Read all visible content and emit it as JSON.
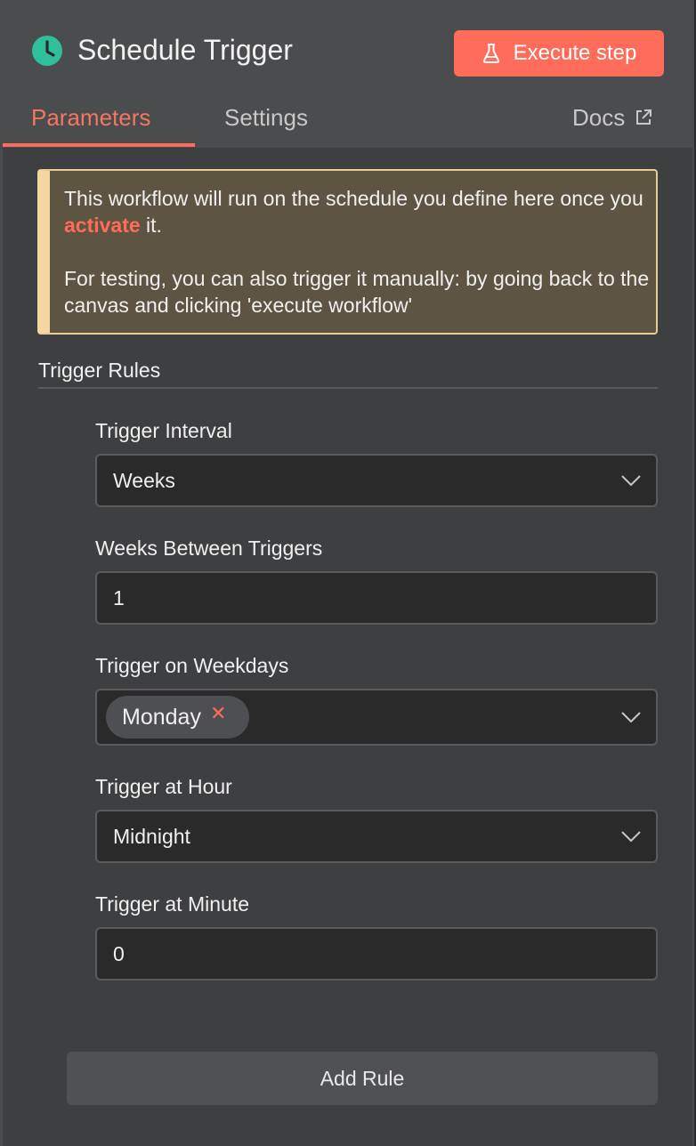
{
  "header": {
    "title": "Schedule Trigger",
    "execute_label": "Execute step",
    "icon": "clock-icon"
  },
  "tabs": [
    {
      "label": "Parameters",
      "active": true
    },
    {
      "label": "Settings",
      "active": false
    }
  ],
  "docs_label": "Docs",
  "notice": {
    "line1_pre": "This workflow will run on the schedule you define here once you ",
    "link": "activate",
    "line1_post": " it.",
    "line2": "For testing, you can also trigger it manually: by going back to the canvas and clicking 'execute workflow'"
  },
  "section_title": "Trigger Rules",
  "fields": {
    "interval": {
      "label": "Trigger Interval",
      "value": "Weeks"
    },
    "weeks_between": {
      "label": "Weeks Between Triggers",
      "value": "1"
    },
    "weekdays": {
      "label": "Trigger on Weekdays",
      "chips": [
        "Monday"
      ]
    },
    "hour": {
      "label": "Trigger at Hour",
      "value": "Midnight"
    },
    "minute": {
      "label": "Trigger at Minute",
      "value": "0"
    }
  },
  "add_rule_label": "Add Rule",
  "colors": {
    "accent": "#ff6d5a",
    "brand_icon": "#2fbf9b",
    "notice_bg": "#5e5442",
    "notice_border": "#f4d7a2"
  }
}
